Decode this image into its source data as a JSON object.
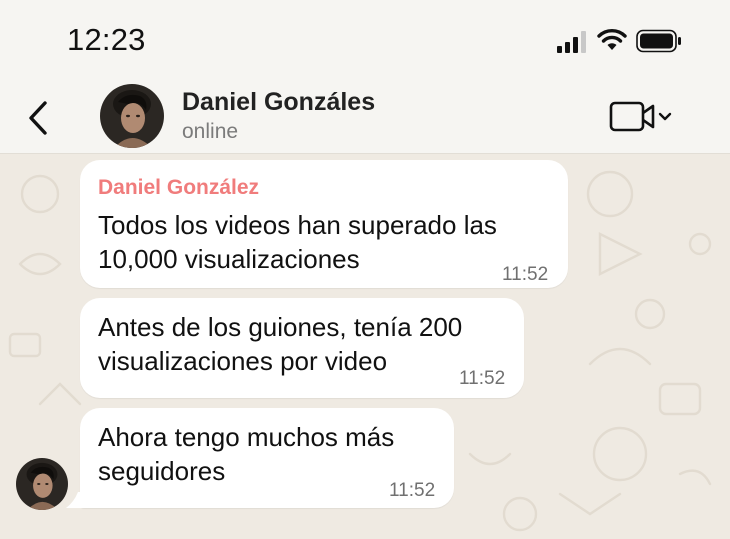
{
  "status_bar": {
    "time": "12:23",
    "icons": [
      "cellular-signal-icon",
      "wifi-icon",
      "battery-icon"
    ]
  },
  "header": {
    "contact_name": "Daniel Gonzáles",
    "status": "online",
    "icons": [
      "back-chevron-icon",
      "video-call-icon",
      "chevron-down-icon"
    ]
  },
  "messages": [
    {
      "sender": "Daniel González",
      "text": "Todos los videos han superado las 10,000 visualizaciones",
      "time": "11:52"
    },
    {
      "text": "Antes de los guiones, tenía 200 visualizaciones por video",
      "time": "11:52"
    },
    {
      "text": "Ahora tengo muchos más seguidores",
      "time": "11:52"
    }
  ],
  "colors": {
    "sender_name": "#f07c7c",
    "chat_background": "#efeae2",
    "bubble": "#ffffff",
    "header_background": "#f6f5f2"
  }
}
